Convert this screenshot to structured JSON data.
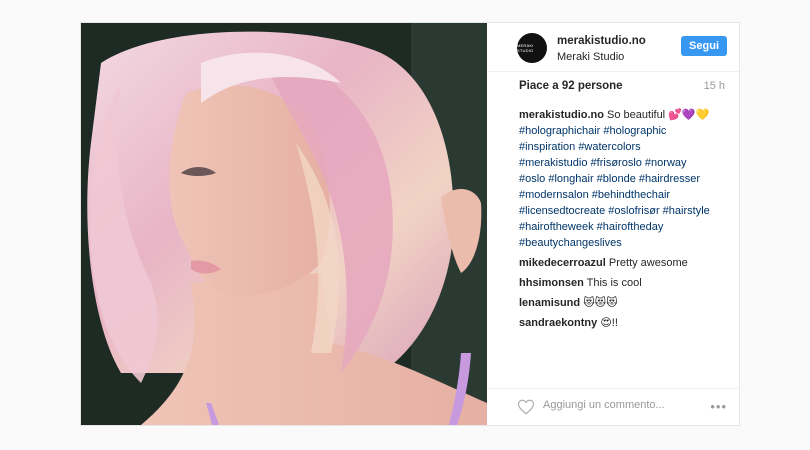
{
  "post": {
    "image_alt": "woman with pastel pink holographic hair",
    "header": {
      "avatar_text": "MERAKI STUDIO",
      "username": "merakistudio.no",
      "full_name": "Meraki Studio",
      "follow_label": "Segui"
    },
    "likes": "Piace a 92 persone",
    "time": "15 h",
    "caption": {
      "user": "merakistudio.no",
      "text": "So beautiful 💕💜💛",
      "hashtags": [
        "#holographichair #holographic",
        "#inspiration #watercolors",
        "#merakistudio #frisøroslo #norway",
        "#oslo #longhair #blonde #hairdresser",
        "#modernsalon #behindthechair",
        "#licensedtocreate #oslofrisør #hairstyle",
        "#hairoftheweek #hairoftheday",
        "#beautychangeslives"
      ]
    },
    "comments": [
      {
        "user": "mikedecerroazul",
        "text": "Pretty awesome"
      },
      {
        "user": "hhsimonsen",
        "text": "This is cool"
      },
      {
        "user": "lenamisund",
        "text": "😻😻😻"
      },
      {
        "user": "sandraekontny",
        "text": "😍!!"
      }
    ],
    "footer": {
      "add_comment_placeholder": "Aggiungi un commento...",
      "more_label": "•••"
    }
  },
  "colors": {
    "follow_button": "#3897f0",
    "hashtag": "#003569",
    "hair_pink": "#e9b6c8"
  }
}
